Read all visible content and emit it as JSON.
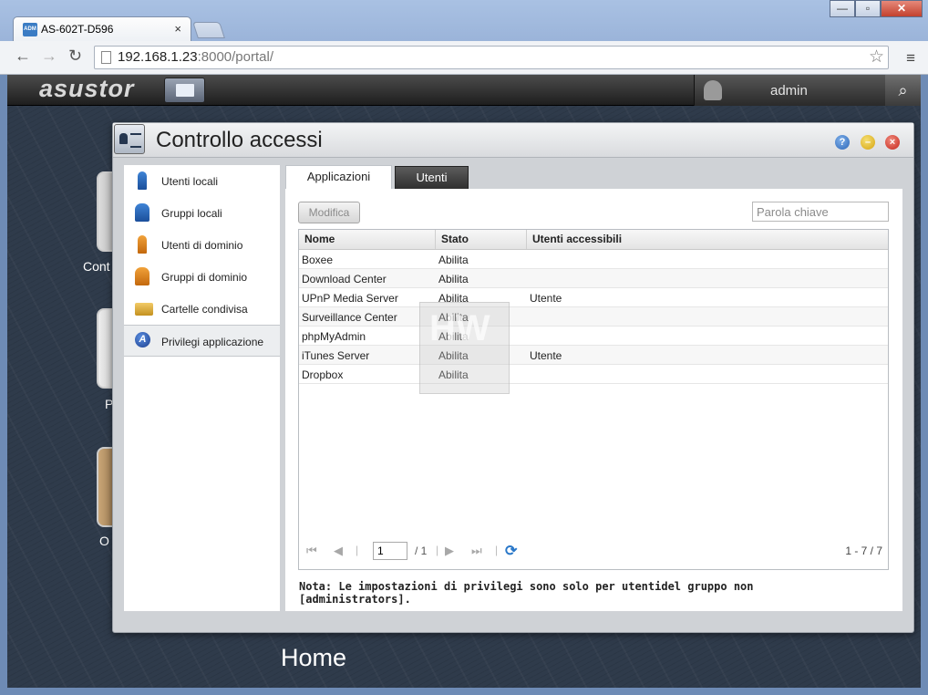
{
  "browser": {
    "tab_title": "AS-602T-D596",
    "tab_close": "×",
    "url_host": "192.168.1.23",
    "url_rest": ":8000/portal/",
    "win_min": "—",
    "win_max": "▫",
    "win_close": "✕"
  },
  "desktop": {
    "logo": "asustor",
    "user": "admin",
    "icon_labels": [
      "Cont",
      "P",
      "O"
    ],
    "home_label": "Home"
  },
  "dialog": {
    "title": "Controllo accessi",
    "help": "?",
    "sidebar": [
      {
        "label": "Utenti locali"
      },
      {
        "label": "Gruppi locali"
      },
      {
        "label": "Utenti di dominio"
      },
      {
        "label": "Gruppi di dominio"
      },
      {
        "label": "Cartelle condivisa"
      },
      {
        "label": "Privilegi applicazione"
      }
    ],
    "tabs": {
      "applicazioni": "Applicazioni",
      "utenti": "Utenti"
    },
    "modify_button": "Modifica",
    "keyword_placeholder": "Parola chiave",
    "columns": [
      "Nome",
      "Stato",
      "Utenti accessibili"
    ],
    "rows": [
      [
        "Boxee",
        "Abilita",
        ""
      ],
      [
        "Download Center",
        "Abilita",
        ""
      ],
      [
        "UPnP Media Server",
        "Abilita",
        "Utente"
      ],
      [
        "Surveillance Center",
        "Abilita",
        ""
      ],
      [
        "phpMyAdmin",
        "Abilita",
        ""
      ],
      [
        "iTunes Server",
        "Abilita",
        "Utente"
      ],
      [
        "Dropbox",
        "Abilita",
        ""
      ]
    ],
    "pager": {
      "page": "1",
      "of": "/ 1",
      "range": "1 - 7 / 7"
    },
    "note": "Nota: Le impostazioni di privilegi sono solo per utentidel gruppo non [administrators].",
    "watermark": "HW"
  }
}
